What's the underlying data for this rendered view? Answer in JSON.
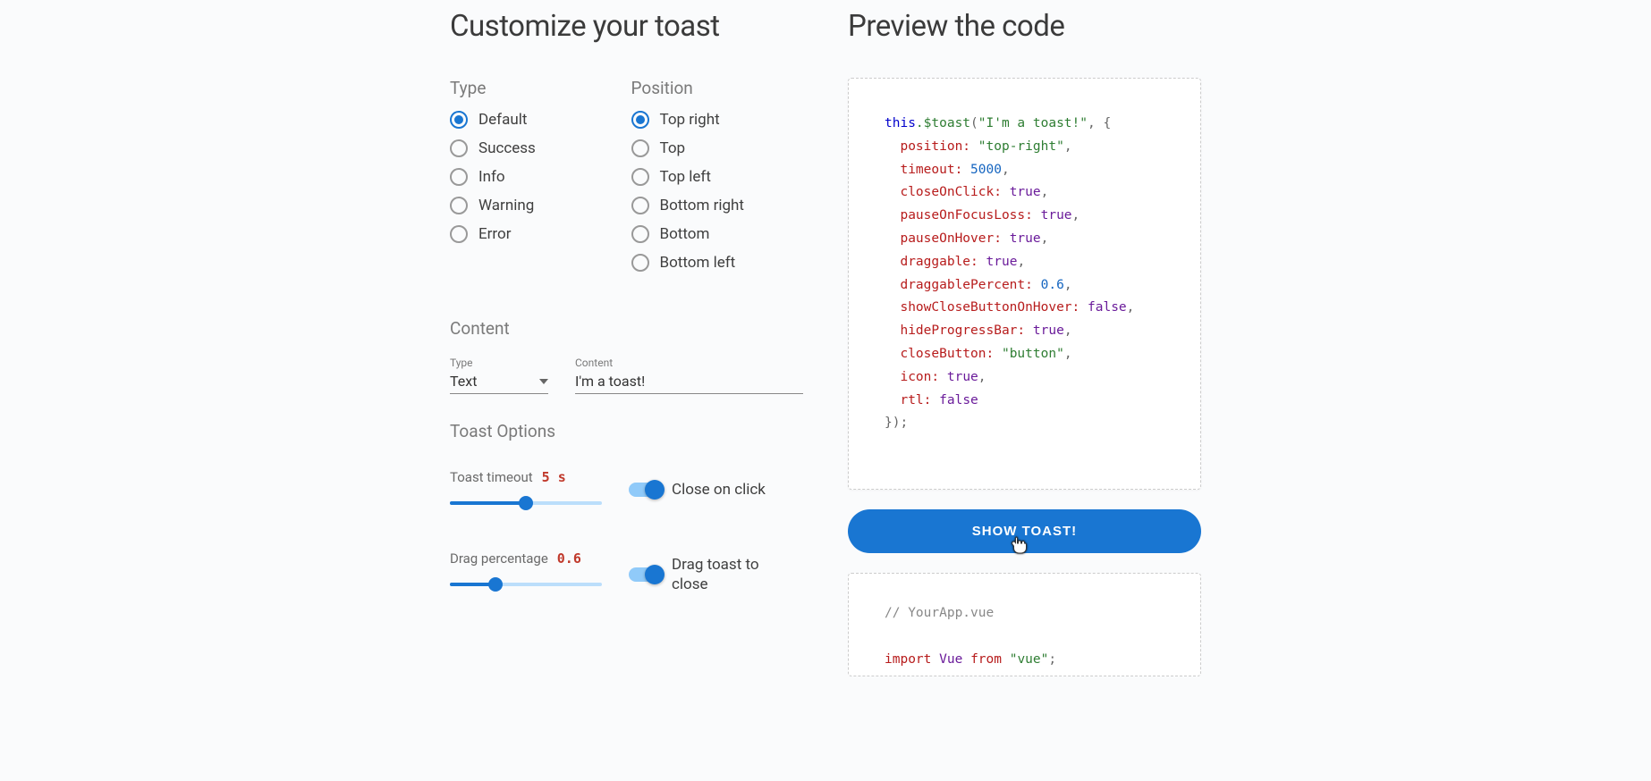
{
  "left": {
    "title": "Customize your toast",
    "type_label": "Type",
    "position_label": "Position",
    "types": [
      "Default",
      "Success",
      "Info",
      "Warning",
      "Error"
    ],
    "type_selected": 0,
    "positions": [
      "Top right",
      "Top",
      "Top left",
      "Bottom right",
      "Bottom",
      "Bottom left"
    ],
    "position_selected": 0,
    "content_section": "Content",
    "content_type_label": "Type",
    "content_type_value": "Text",
    "content_field_label": "Content",
    "content_field_value": "I'm a toast!",
    "options_section": "Toast Options",
    "timeout_label": "Toast timeout",
    "timeout_value": "5 s",
    "timeout_pct": 50,
    "close_on_click_label": "Close on click",
    "drag_pct_label": "Drag percentage",
    "drag_pct_value": "0.6",
    "drag_pct_slider": 30,
    "drag_to_close_label": "Drag toast to close"
  },
  "right": {
    "title": "Preview the code",
    "button_label": "SHOW TOAST!",
    "code": {
      "this": "this",
      "fn": ".$toast",
      "arg_str": "\"I'm a toast!\"",
      "props": [
        {
          "k": "position",
          "v": "\"top-right\"",
          "t": "str"
        },
        {
          "k": "timeout",
          "v": "5000",
          "t": "num"
        },
        {
          "k": "closeOnClick",
          "v": "true",
          "t": "bool"
        },
        {
          "k": "pauseOnFocusLoss",
          "v": "true",
          "t": "bool"
        },
        {
          "k": "pauseOnHover",
          "v": "true",
          "t": "bool"
        },
        {
          "k": "draggable",
          "v": "true",
          "t": "bool"
        },
        {
          "k": "draggablePercent",
          "v": "0.6",
          "t": "num"
        },
        {
          "k": "showCloseButtonOnHover",
          "v": "false",
          "t": "bool"
        },
        {
          "k": "hideProgressBar",
          "v": "true",
          "t": "bool"
        },
        {
          "k": "closeButton",
          "v": "\"button\"",
          "t": "str"
        },
        {
          "k": "icon",
          "v": "true",
          "t": "bool"
        },
        {
          "k": "rtl",
          "v": "false",
          "t": "bool"
        }
      ],
      "close": "});"
    },
    "second": {
      "comment": "// YourApp.vue",
      "import_kw": "import",
      "import_id": "Vue",
      "from_kw": "from",
      "from_str": "\"vue\"",
      "semi": ";"
    }
  }
}
